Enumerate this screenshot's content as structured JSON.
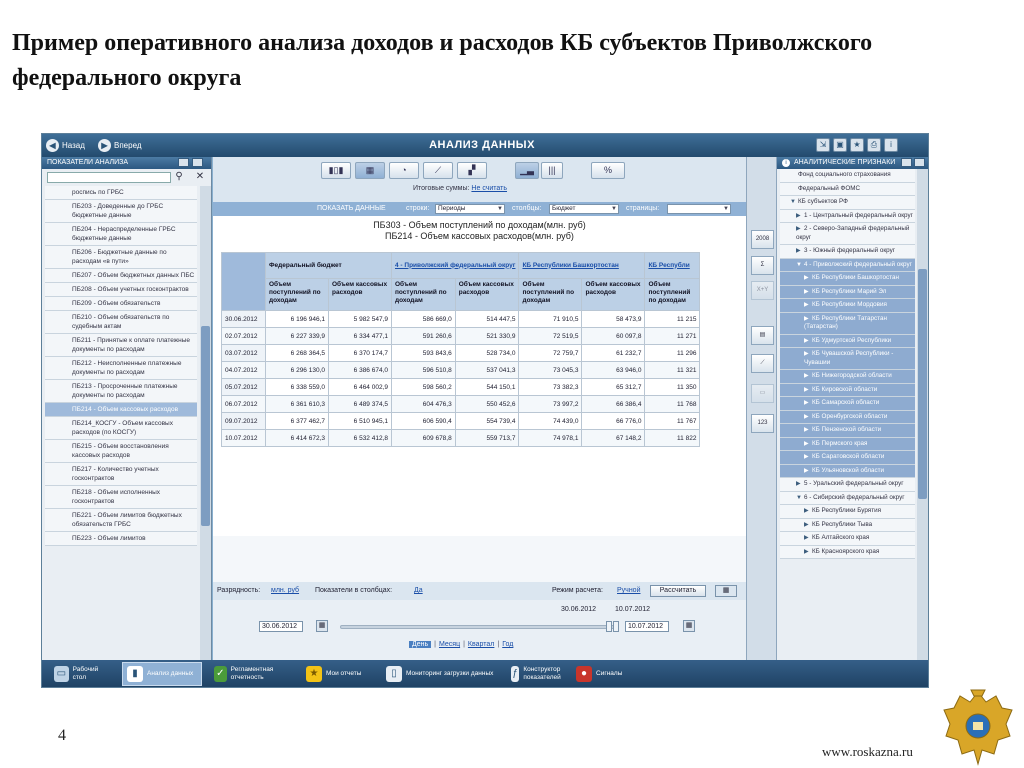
{
  "slide": {
    "title": "Пример оперативного анализа доходов и расходов КБ субъектов Приволжского федерального округа",
    "page_number": "4",
    "website": "www.roskazna.ru"
  },
  "topbar": {
    "back_label": "Назад",
    "forward_label": "Вперед",
    "title": "АНАЛИЗ ДАННЫХ"
  },
  "left_panel": {
    "header": "ПОКАЗАТЕЛИ АНАЛИЗА",
    "items": [
      "роспись по ГРБС",
      "ПБ203 - Доведенные до ГРБС бюджетные данные",
      "ПБ204 - Нераспределенные ГРБС бюджетные данные",
      "ПБ206 - Бюджетные данные по расходам «в пути»",
      "ПБ207 - Объем бюджетных данных ПБС",
      "ПБ208 - Объем учетных госконтрактов",
      "ПБ209 - Объем обязательств",
      "ПБ210 - Объем обязательств по судебным актам",
      "ПБ211 - Принятые к оплате платежные документы по расходам",
      "ПБ212 - Неисполненные платежные документы по расходам",
      "ПБ213 - Просроченные платежные документы по расходам",
      "ПБ214 - Объем кассовых расходов",
      "ПБ214_КОСГУ - Объем кассовых расходов (по КОСГУ)",
      "ПБ215 - Объем восстановления кассовых расходов",
      "ПБ217 - Количество учетных госконтрактов",
      "ПБ218 - Объем исполненных госконтрактов",
      "ПБ221 - Объем лимитов бюджетных обязательств ГРБС",
      "ПБ223 - Объем лимитов"
    ],
    "selected_index": 11
  },
  "center": {
    "totals_label": "Итоговые суммы:",
    "totals_link": "Не считать",
    "show_data_label": "ПОКАЗАТЬ ДАННЫЕ",
    "rows_label": "строки:",
    "rows_value": "Периоды",
    "cols_label": "столбцы:",
    "cols_value": "Бюджет",
    "pages_label": "страницы:",
    "pages_value": "",
    "percent_label": "%",
    "grid_title_1": "ПБ303 - Объем поступлений по доходам(млн. руб)",
    "grid_title_2": "ПБ214 - Объем кассовых расходов(млн. руб)",
    "group_headers": [
      "Федеральный бюджет",
      "4 - Приволжский федеральный округ",
      "КБ Республики Башкортостан",
      "КБ Республи"
    ],
    "sub_headers": [
      "Объем поступлений по доходам",
      "Объем кассовых расходов",
      "Объем поступлений по доходам",
      "Объем кассовых расходов",
      "Объем поступлений по доходам",
      "Объем кассовых расходов",
      "Объем поступлений по доходам"
    ],
    "rows": [
      {
        "date": "30.06.2012",
        "v": [
          "6 196 946,1",
          "5 982 547,9",
          "586 669,0",
          "514 447,5",
          "71 910,5",
          "58 473,9",
          "11 215"
        ]
      },
      {
        "date": "02.07.2012",
        "v": [
          "6 227 339,9",
          "6 334 477,1",
          "591 260,6",
          "521 330,9",
          "72 519,5",
          "60 097,8",
          "11 271"
        ]
      },
      {
        "date": "03.07.2012",
        "v": [
          "6 268 364,5",
          "6 370 174,7",
          "593 843,6",
          "528 734,0",
          "72 759,7",
          "61 232,7",
          "11 296"
        ]
      },
      {
        "date": "04.07.2012",
        "v": [
          "6 296 130,0",
          "6 386 674,0",
          "596 510,8",
          "537 041,3",
          "73 045,3",
          "63 946,0",
          "11 321"
        ]
      },
      {
        "date": "05.07.2012",
        "v": [
          "6 338 559,0",
          "6 464 002,9",
          "598 560,2",
          "544 150,1",
          "73 382,3",
          "65 312,7",
          "11 350"
        ]
      },
      {
        "date": "06.07.2012",
        "v": [
          "6 361 610,3",
          "6 489 374,5",
          "604 476,3",
          "550 452,6",
          "73 997,2",
          "66 386,4",
          "11 768"
        ]
      },
      {
        "date": "09.07.2012",
        "v": [
          "6 377 462,7",
          "6 510 945,1",
          "606 590,4",
          "554 739,4",
          "74 439,0",
          "66 776,0",
          "11 767"
        ]
      },
      {
        "date": "10.07.2012",
        "v": [
          "6 414 672,3",
          "6 532 412,8",
          "609 678,8",
          "559 713,7",
          "74 978,1",
          "67 148,2",
          "11 822"
        ]
      }
    ],
    "precision_label": "Разрядность:",
    "precision_value": "млн. руб",
    "cols_indicators_label": "Показатели в столбцах:",
    "cols_indicators_value": "Да",
    "calc_mode_label": "Режим расчета:",
    "calc_mode_value": "Ручной",
    "calc_button": "Рассчитать",
    "date_from": "30.06.2012",
    "date_to": "10.07.2012",
    "range_start": "30.06.2012",
    "range_end": "10.07.2012",
    "periods": [
      "День",
      "Месяц",
      "Квартал",
      "Год"
    ]
  },
  "right_panel": {
    "header": "АНАЛИТИЧЕСКИЕ ПРИЗНАКИ",
    "items": [
      {
        "t": "Фонд социального страхования",
        "lvl": 1,
        "tri": "",
        "blue": false
      },
      {
        "t": "Федеральный ФОМС",
        "lvl": 1,
        "tri": "",
        "blue": false
      },
      {
        "t": "КБ субъектов РФ",
        "lvl": 1,
        "tri": "▼",
        "blue": false
      },
      {
        "t": "1 - Центральный федеральный округ",
        "lvl": 2,
        "tri": "▶",
        "blue": false
      },
      {
        "t": "2 - Северо-Западный федеральный округ",
        "lvl": 2,
        "tri": "▶",
        "blue": false
      },
      {
        "t": "3 - Южный федеральный округ",
        "lvl": 2,
        "tri": "▶",
        "blue": false
      },
      {
        "t": "4 - Приволжский федеральный округ",
        "lvl": 2,
        "tri": "▼",
        "blue": true
      },
      {
        "t": "КБ Республики Башкортостан",
        "lvl": 3,
        "tri": "▶",
        "blue": true
      },
      {
        "t": "КБ Республики Марий Эл",
        "lvl": 3,
        "tri": "▶",
        "blue": true
      },
      {
        "t": "КБ Республики Мордовия",
        "lvl": 3,
        "tri": "▶",
        "blue": true
      },
      {
        "t": "КБ Республики Татарстан (Татарстан)",
        "lvl": 3,
        "tri": "▶",
        "blue": true
      },
      {
        "t": "КБ Удмуртской Республики",
        "lvl": 3,
        "tri": "▶",
        "blue": true
      },
      {
        "t": "КБ Чувашской Республики - Чувашии",
        "lvl": 3,
        "tri": "▶",
        "blue": true
      },
      {
        "t": "КБ Нижегородской области",
        "lvl": 3,
        "tri": "▶",
        "blue": true
      },
      {
        "t": "КБ Кировской области",
        "lvl": 3,
        "tri": "▶",
        "blue": true
      },
      {
        "t": "КБ Самарской области",
        "lvl": 3,
        "tri": "▶",
        "blue": true
      },
      {
        "t": "КБ Оренбургской области",
        "lvl": 3,
        "tri": "▶",
        "blue": true
      },
      {
        "t": "КБ Пензенской области",
        "lvl": 3,
        "tri": "▶",
        "blue": true
      },
      {
        "t": "КБ Пермского края",
        "lvl": 3,
        "tri": "▶",
        "blue": true
      },
      {
        "t": "КБ Саратовской области",
        "lvl": 3,
        "tri": "▶",
        "blue": true
      },
      {
        "t": "КБ Ульяновской области",
        "lvl": 3,
        "tri": "▶",
        "blue": true
      },
      {
        "t": "5 - Уральский федеральный округ",
        "lvl": 2,
        "tri": "▶",
        "blue": false
      },
      {
        "t": "6 - Сибирский федеральный округ",
        "lvl": 2,
        "tri": "▼",
        "blue": false
      },
      {
        "t": "КБ Республики Бурятия",
        "lvl": 3,
        "tri": "▶",
        "blue": false
      },
      {
        "t": "КБ Республики Тыва",
        "lvl": 3,
        "tri": "▶",
        "blue": false
      },
      {
        "t": "КБ Алтайского края",
        "lvl": 3,
        "tri": "▶",
        "blue": false
      },
      {
        "t": "КБ Красноярского края",
        "lvl": 3,
        "tri": "▶",
        "blue": false
      }
    ]
  },
  "taskbar": {
    "items": [
      {
        "label": "Рабочий стол",
        "icon": "desktop-icon",
        "on": false
      },
      {
        "label": "Анализ данных",
        "icon": "chart-icon",
        "on": true
      },
      {
        "label": "Регламентная отчетность",
        "icon": "checklist-icon",
        "on": false
      },
      {
        "label": "Мои отчеты",
        "icon": "star-icon",
        "on": false
      },
      {
        "label": "Мониторинг загрузки данных",
        "icon": "monitor-icon",
        "on": false
      },
      {
        "label": "Конструктор показателей",
        "icon": "formula-icon",
        "on": false
      },
      {
        "label": "Сигналы",
        "icon": "signal-icon",
        "on": false
      }
    ]
  },
  "colors": {
    "header_blue": "#234a6d",
    "selection_blue": "#8eabd0",
    "link_blue": "#1a4ea8"
  }
}
